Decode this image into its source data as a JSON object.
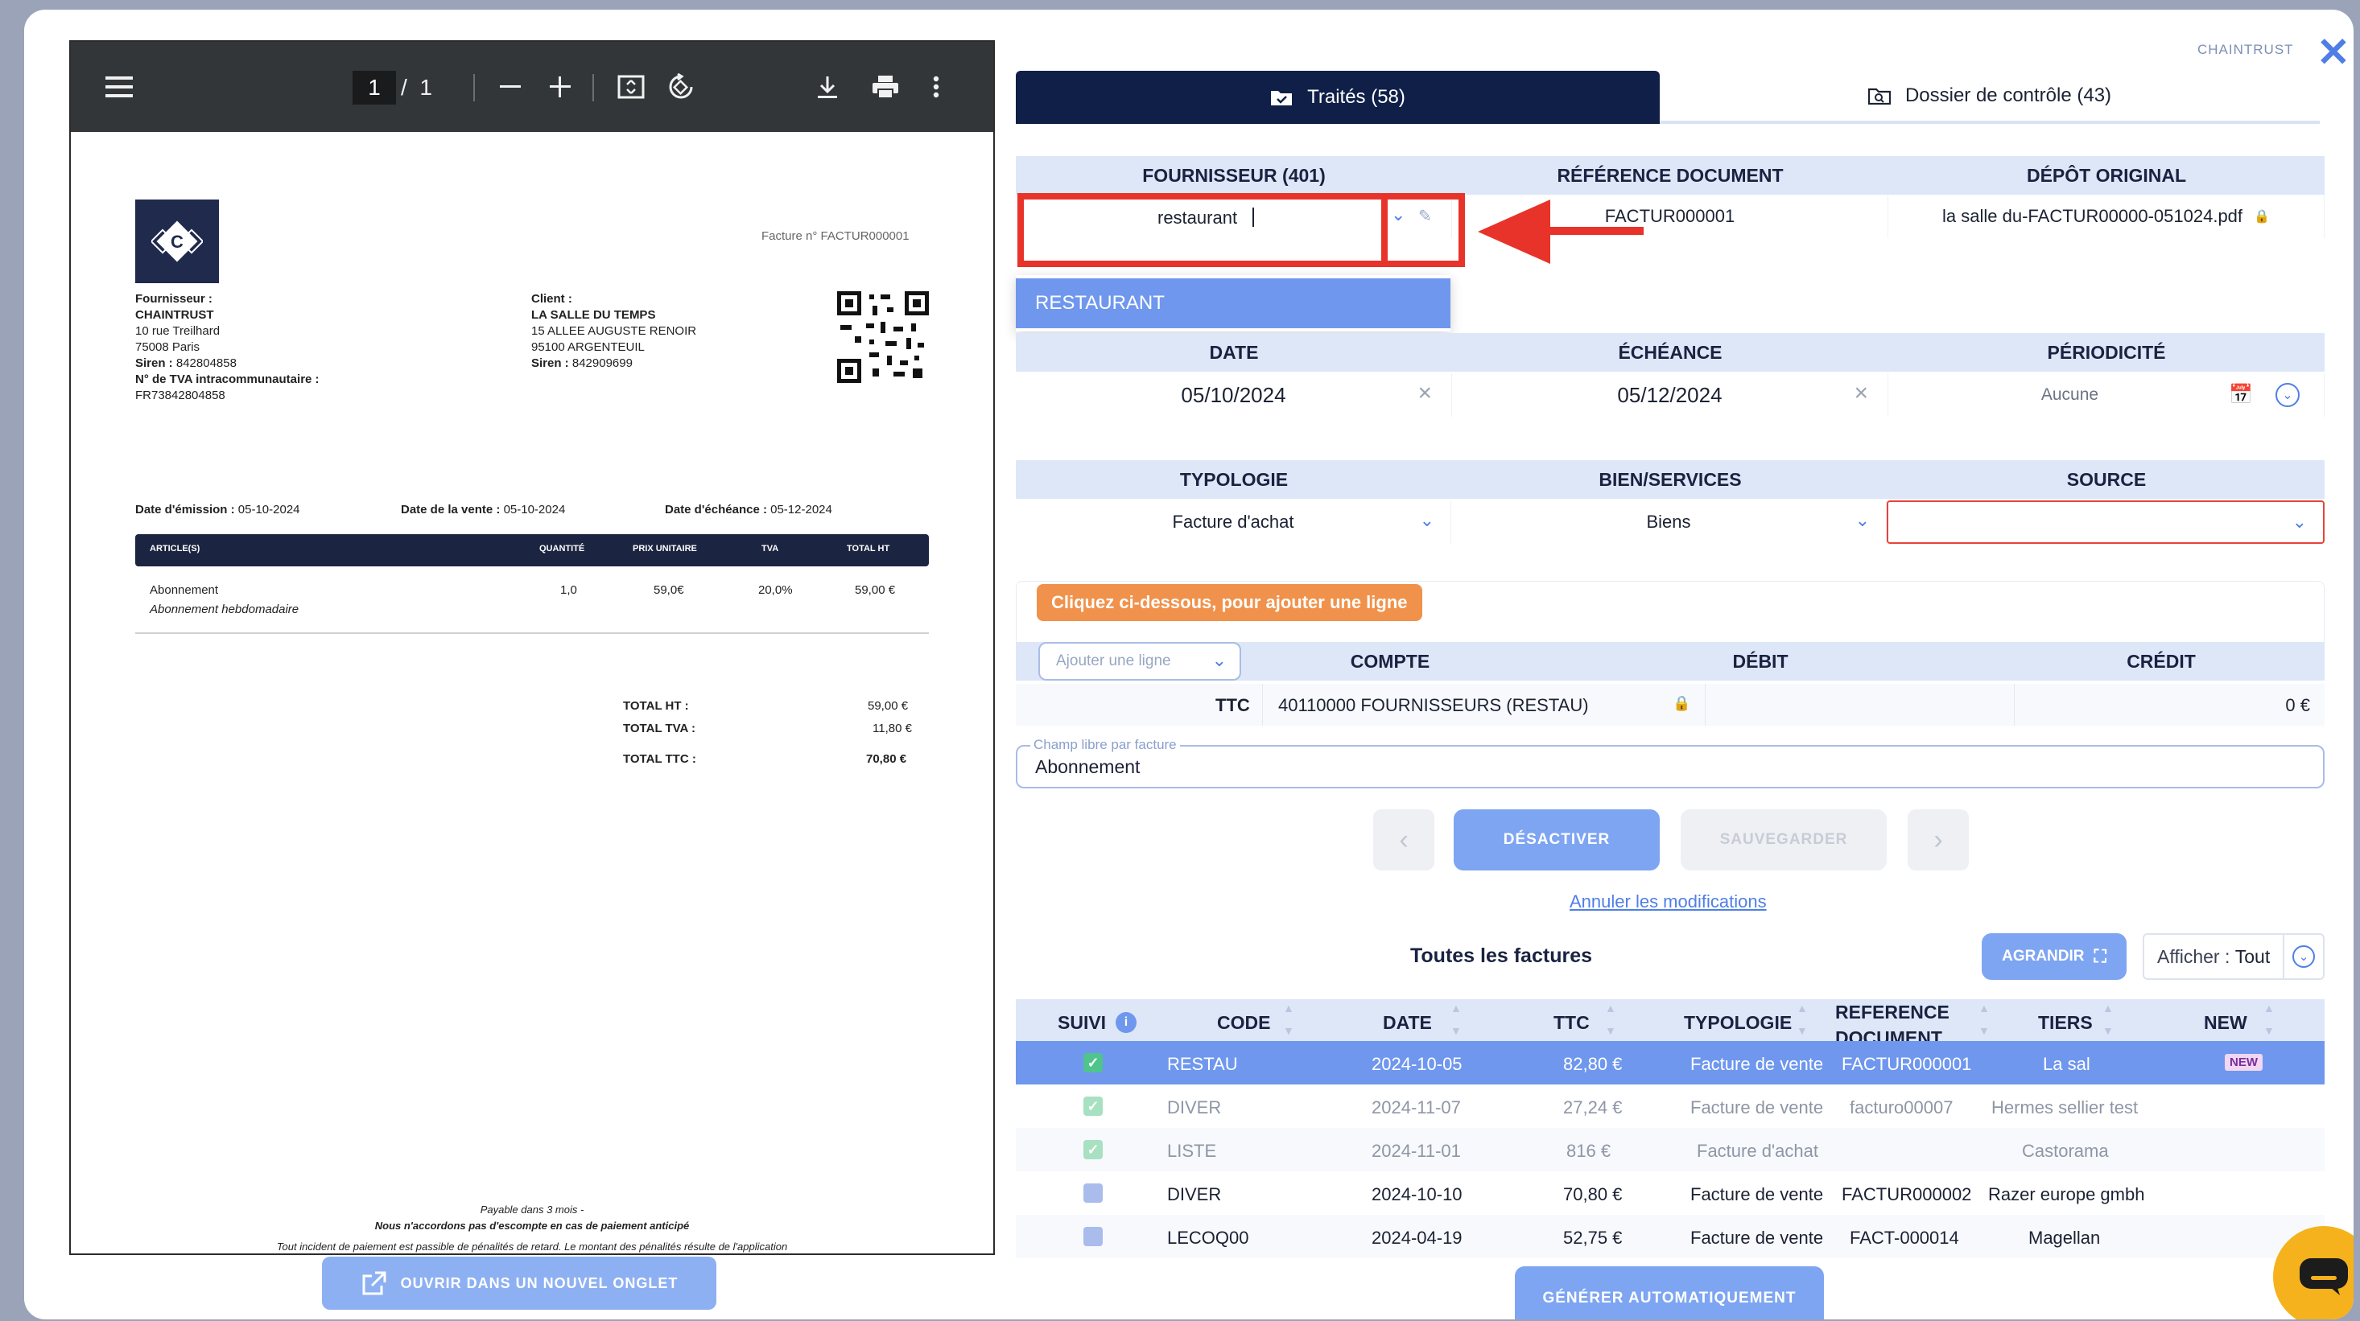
{
  "pdf_viewer": {
    "page_current": "1",
    "page_total": "1",
    "open_new_tab_label": "OUVRIR DANS UN NOUVEL ONGLET",
    "invoice": {
      "invoice_number": "Facture n° FACTUR000001",
      "supplier_label": "Fournisseur :",
      "supplier_name": "CHAINTRUST",
      "supplier_address1": "10 rue Treilhard",
      "supplier_address2": "75008 Paris",
      "supplier_siren_label": "Siren :",
      "supplier_siren": "842804858",
      "supplier_vat_label": "N° de TVA intracommunautaire :",
      "supplier_vat": "FR73842804858",
      "client_label": "Client :",
      "client_name": "LA SALLE DU TEMPS",
      "client_address1": "15 ALLEE AUGUSTE RENOIR",
      "client_address2": "95100 ARGENTEUIL",
      "client_siren_label": "Siren :",
      "client_siren": "842909699",
      "issue_label": "Date d'émission :",
      "issue_date": "05-10-2024",
      "sale_label": "Date de la vente :",
      "sale_date": "05-10-2024",
      "due_label": "Date d'échéance :",
      "due_date": "05-12-2024",
      "table_headers": [
        "ARTICLE(S)",
        "QUANTITÉ",
        "PRIX UNITAIRE",
        "TVA",
        "TOTAL HT"
      ],
      "line_item": {
        "name": "Abonnement",
        "description": "Abonnement hebdomadaire",
        "quantity": "1,0",
        "unit_price": "59,0€",
        "vat": "20,0%",
        "total": "59,00 €"
      },
      "total_ht_label": "TOTAL HT :",
      "total_ht": "59,00 €",
      "total_tva_label": "TOTAL TVA :",
      "total_tva": "11,80 €",
      "total_ttc_label": "TOTAL TTC :",
      "total_ttc": "70,80 €",
      "footer1": "Payable dans 3 mois -",
      "footer2": "Nous n'accordons pas d'escompte en cas de paiement anticipé",
      "footer3": "Tout incident de paiement est passible de pénalités de retard. Le montant des pénalités résulte de l'application"
    }
  },
  "header": {
    "brand": "CHAINTRUST",
    "tab_processed": "Traités (58)",
    "tab_control": "Dossier de contrôle (43)"
  },
  "form": {
    "supplier_header": "FOURNISSEUR (401)",
    "docref_header": "RÉFÉRENCE DOCUMENT",
    "original_header": "DÉPÔT ORIGINAL",
    "supplier_input": "restaurant",
    "docref_value": "FACTUR000001",
    "original_value": "la salle du-FACTUR00000-051024.pdf",
    "dropdown_option": "RESTAURANT",
    "date_header": "DATE",
    "due_header": "ÉCHÉANCE",
    "period_header": "PÉRIODICITÉ",
    "date_value": "05/10/2024",
    "due_value": "05/12/2024",
    "period_value": "Aucune",
    "type_header": "TYPOLOGIE",
    "goods_header": "BIEN/SERVICES",
    "source_header": "SOURCE",
    "type_value": "Facture d'achat",
    "goods_value": "Biens",
    "source_value": ""
  },
  "lines": {
    "hint": "Cliquez ci-dessous, pour ajouter une ligne",
    "add_line_placeholder": "Ajouter une ligne",
    "account_header": "COMPTE",
    "debit_header": "DÉBIT",
    "credit_header": "CRÉDIT",
    "row_label": "TTC",
    "row_account": "40110000 FOURNISSEURS (RESTAU)",
    "row_debit": "",
    "row_credit": "0 €",
    "free_label": "Champ libre par facture",
    "free_value": "Abonnement"
  },
  "actions": {
    "deactivate": "DÉSACTIVER",
    "save": "SAUVEGARDER",
    "cancel": "Annuler les modifications"
  },
  "invoices": {
    "title": "Toutes les factures",
    "enlarge": "AGRANDIR",
    "show_label": "Afficher :",
    "show_value": "Tout",
    "columns": [
      "SUIVI",
      "CODE",
      "DATE",
      "TTC",
      "TYPOLOGIE",
      "REFERENCE DOCUMENT",
      "TIERS",
      "NEW"
    ],
    "rows": [
      {
        "code": "RESTAU",
        "date": "2024-10-05",
        "ttc": "82,80 €",
        "type": "Facture de vente",
        "ref": "FACTUR000001",
        "tiers": "La sal",
        "new": "NEW"
      },
      {
        "code": "DIVER",
        "date": "2024-11-07",
        "ttc": "27,24 €",
        "type": "Facture de vente",
        "ref": "facturo00007",
        "tiers": "Hermes sellier test",
        "new": ""
      },
      {
        "code": "LISTE",
        "date": "2024-11-01",
        "ttc": "816 €",
        "type": "Facture d'achat",
        "ref": "",
        "tiers": "Castorama",
        "new": ""
      },
      {
        "code": "DIVER",
        "date": "2024-10-10",
        "ttc": "70,80 €",
        "type": "Facture de vente",
        "ref": "FACTUR000002",
        "tiers": "Razer europe gmbh",
        "new": ""
      },
      {
        "code": "LECOQ00",
        "date": "2024-04-19",
        "ttc": "52,75 €",
        "type": "Facture de vente",
        "ref": "FACT-000014",
        "tiers": "Magellan",
        "new": ""
      }
    ],
    "generate": "GÉNÉRER AUTOMATIQUEMENT"
  },
  "colors": {
    "accent": "#4f7fe6",
    "navy": "#0f1f47",
    "highlight_red": "#e8332a",
    "orange": "#f0924b",
    "selected_row": "#6f97ee"
  }
}
